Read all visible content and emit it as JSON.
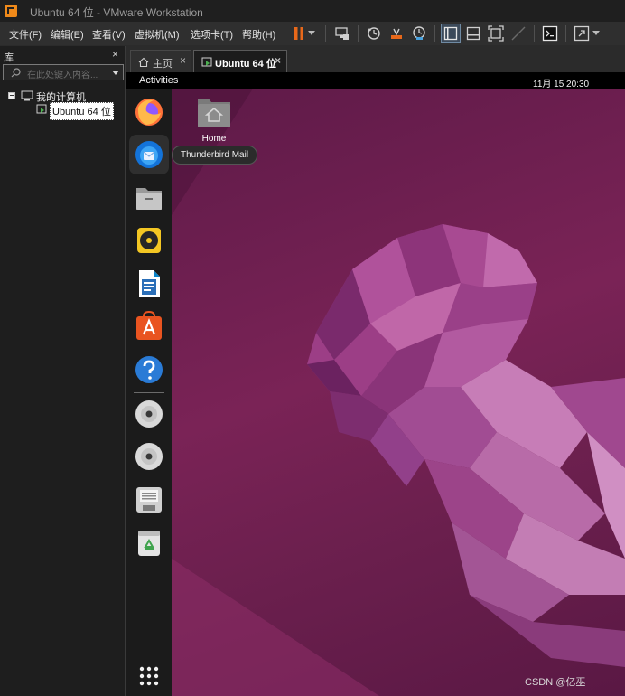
{
  "window": {
    "title": "Ubuntu 64 位 - VMware Workstation"
  },
  "menu": {
    "items": [
      "文件(F)",
      "编辑(E)",
      "查看(V)",
      "虚拟机(M)",
      "选项卡(T)",
      "帮助(H)"
    ]
  },
  "toolbar": {
    "icons": [
      "pause-icon",
      "send-keys-icon",
      "snapshot-icon",
      "revert-snapshot-icon",
      "snapshot-manager-icon",
      "split-view-icon",
      "library-toggle-icon",
      "fit-window-icon",
      "fullscreen-icon",
      "console-icon",
      "stretch-icon"
    ]
  },
  "library": {
    "title": "库",
    "close": "×",
    "search_placeholder": "在此处键入内容...",
    "root_label": "我的计算机",
    "vm_label": "Ubuntu 64 位"
  },
  "tabs": [
    {
      "label": "主页",
      "close": "×"
    },
    {
      "label": "Ubuntu 64 位",
      "close": "×"
    }
  ],
  "guest": {
    "activities": "Activities",
    "clock": "11月 15  20:30",
    "home_icon_label": "Home",
    "tooltip": "Thunderbird Mail",
    "dock_items": [
      "firefox-icon",
      "thunderbird-icon",
      "files-icon",
      "rhythmbox-icon",
      "libreoffice-writer-icon",
      "app-center-icon",
      "help-icon",
      "dvd-drive-icon",
      "dvd-drive-2-icon",
      "floppy-icon",
      "trash-icon",
      "show-apps-icon"
    ]
  },
  "watermark": "CSDN @亿巫",
  "colors": {
    "wallpaper": "#6e1f50",
    "ubuntu_orange": "#e95420",
    "pause_orange": "#e8681a"
  }
}
